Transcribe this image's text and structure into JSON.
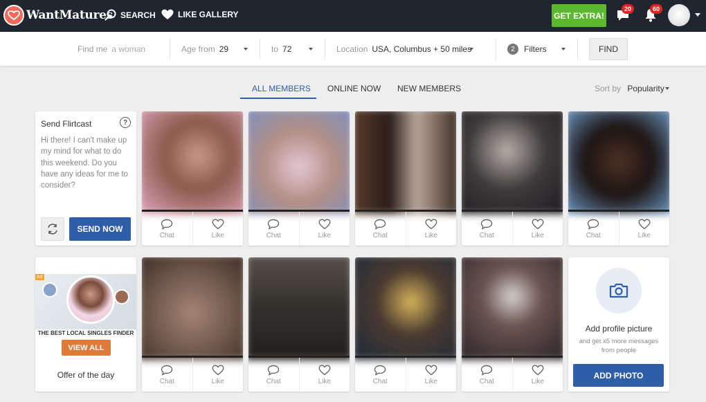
{
  "brand": {
    "logo_text": "WantMatures"
  },
  "nav": {
    "search_label": "SEARCH",
    "like_gallery_label": "LIKE GALLERY",
    "get_extra_label": "GET EXTRA!",
    "messages_count": "20",
    "notifications_count": "60"
  },
  "search": {
    "find_me_label": "Find me",
    "find_me_value": "a woman",
    "age_from_label": "Age from",
    "age_from_value": "29",
    "age_to_label": "to",
    "age_to_value": "72",
    "location_label": "Location",
    "location_value": "USA, Columbus + 50 miles",
    "filters_count": "2",
    "filters_label": "Filters",
    "find_button": "FIND"
  },
  "tabs": [
    {
      "label": "ALL MEMBERS",
      "active": true
    },
    {
      "label": "ONLINE NOW",
      "active": false
    },
    {
      "label": "NEW MEMBERS",
      "active": false
    }
  ],
  "sort": {
    "label": "Sort by",
    "value": "Popularity"
  },
  "flirtcast": {
    "title": "Send Flirtcast",
    "message": "Hi there! I can't make up my mind for what to do this weekend. Do you have any ideas for me to consider?",
    "send_label": "SEND NOW"
  },
  "member_actions": {
    "chat_label": "Chat",
    "like_label": "Like"
  },
  "members": [
    {
      "photo_colors": [
        "#8a5a4a",
        "#c79b8a",
        "#e4a8c4"
      ]
    },
    {
      "photo_colors": [
        "#b38f86",
        "#e3c8d4",
        "#7a8fc1"
      ]
    },
    {
      "photo_colors": [
        "#2a1c18",
        "#b9a79a",
        "#5b3d2e"
      ]
    },
    {
      "photo_colors": [
        "#3e3a3c",
        "#1e1c20",
        "#b7b0a8"
      ]
    },
    {
      "photo_colors": [
        "#4d3125",
        "#1d1412",
        "#6b98c5"
      ]
    },
    {
      "photo_colors": [
        "#7b6255",
        "#3b2a24",
        "#a38575"
      ]
    },
    {
      "photo_colors": [
        "#32302c",
        "#5a504a",
        "#221e1c"
      ]
    },
    {
      "photo_colors": [
        "#1c2a3a",
        "#d7b45a",
        "#4a3a30"
      ]
    },
    {
      "photo_colors": [
        "#2a2226",
        "#6a5450",
        "#d8d2d0"
      ]
    }
  ],
  "ad": {
    "tag": "Ad",
    "heading": "THE BEST LOCAL SINGLES FINDER",
    "button_label": "VIEW ALL",
    "offer_label": "Offer of the day"
  },
  "add_photo": {
    "title": "Add profile picture",
    "subtitle": "and get x5 more messages from people",
    "button_label": "ADD PHOTO"
  },
  "colors": {
    "topbar_bg": "#1f2630",
    "accent_blue": "#2f5ea9",
    "extra_green": "#5cb82e",
    "badge_red": "#e02424",
    "ad_orange": "#e07a3b"
  }
}
